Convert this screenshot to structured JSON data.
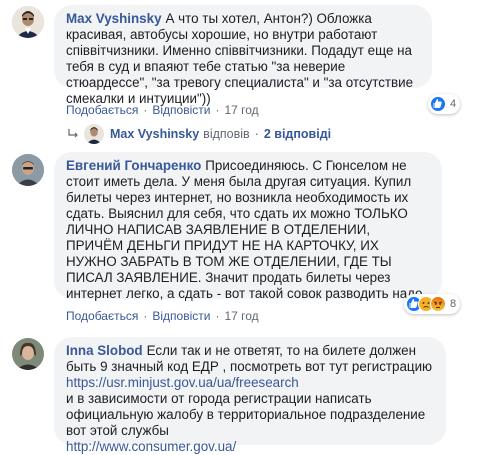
{
  "comments": [
    {
      "author": "Max Vyshinsky",
      "text": "А что ты хотел, Антон?) Обложка красивая, автобусы хорошие, но внутри работают співвітчизники. Именно співвітчизники. Подадут еще на тебя в суд и впаяют тебе статью \"за неверие стюардессе\", \"за тревогу специалиста\" и \"за отсутствие смекалки и интуиции\"))",
      "reaction_count": "4",
      "reactions": [
        "like-icon"
      ],
      "action_like": "Подобається",
      "action_reply": "Відповісти",
      "time": "17 год"
    },
    {
      "author": "Евгений Гончаренко",
      "text": "Присоединяюсь. С Гюнселом не стоит иметь дела. У меня была другая ситуация. Купил билеты через интернет, но возникла необходимость их сдать. Выяснил для себя, что сдать их можно ТОЛЬКО ЛИЧНО НАПИСАВ ЗАЯВЛЕНИЕ В ОТДЕЛЕНИИ, ПРИЧЁМ ДЕНЬГИ ПРИДУТ НЕ НА КАРТОЧКУ, ИХ НУЖНО ЗАБРАТЬ В ТОМ ЖЕ ОТДЕЛЕНИИ, ГДЕ ТЫ ПИСАЛ ЗАЯВЛЕНИЕ. Значит продать билеты через интернет легко, а сдать - вот такой совок разводить надо.",
      "reaction_count": "8",
      "reactions": [
        "like-icon",
        "sad-icon",
        "angry-icon"
      ],
      "action_like": "Подобається",
      "action_reply": "Відповісти",
      "time": "17 год"
    },
    {
      "author": "Inna Slobod",
      "text_1": "Если так и не ответят, то на билете должен быть 9 значный код ЕДР , посмотреть вот тут регистрацию",
      "link_1": "https://usr.minjust.gov.ua/ua/freesearch",
      "text_2": "и в зависимости от города регистрации написать официальную жалобу в территориальное подразделение вот этой службы",
      "link_2": "http://www.consumer.gov.ua/"
    }
  ],
  "reply_summary": {
    "name": "Max Vyshinsky",
    "verb": "відповів",
    "dot": "·",
    "count": "2 відповіді"
  },
  "separator": "·",
  "colors": {
    "link": "#385898",
    "bubble": "#f2f3f5",
    "meta": "#606770"
  }
}
